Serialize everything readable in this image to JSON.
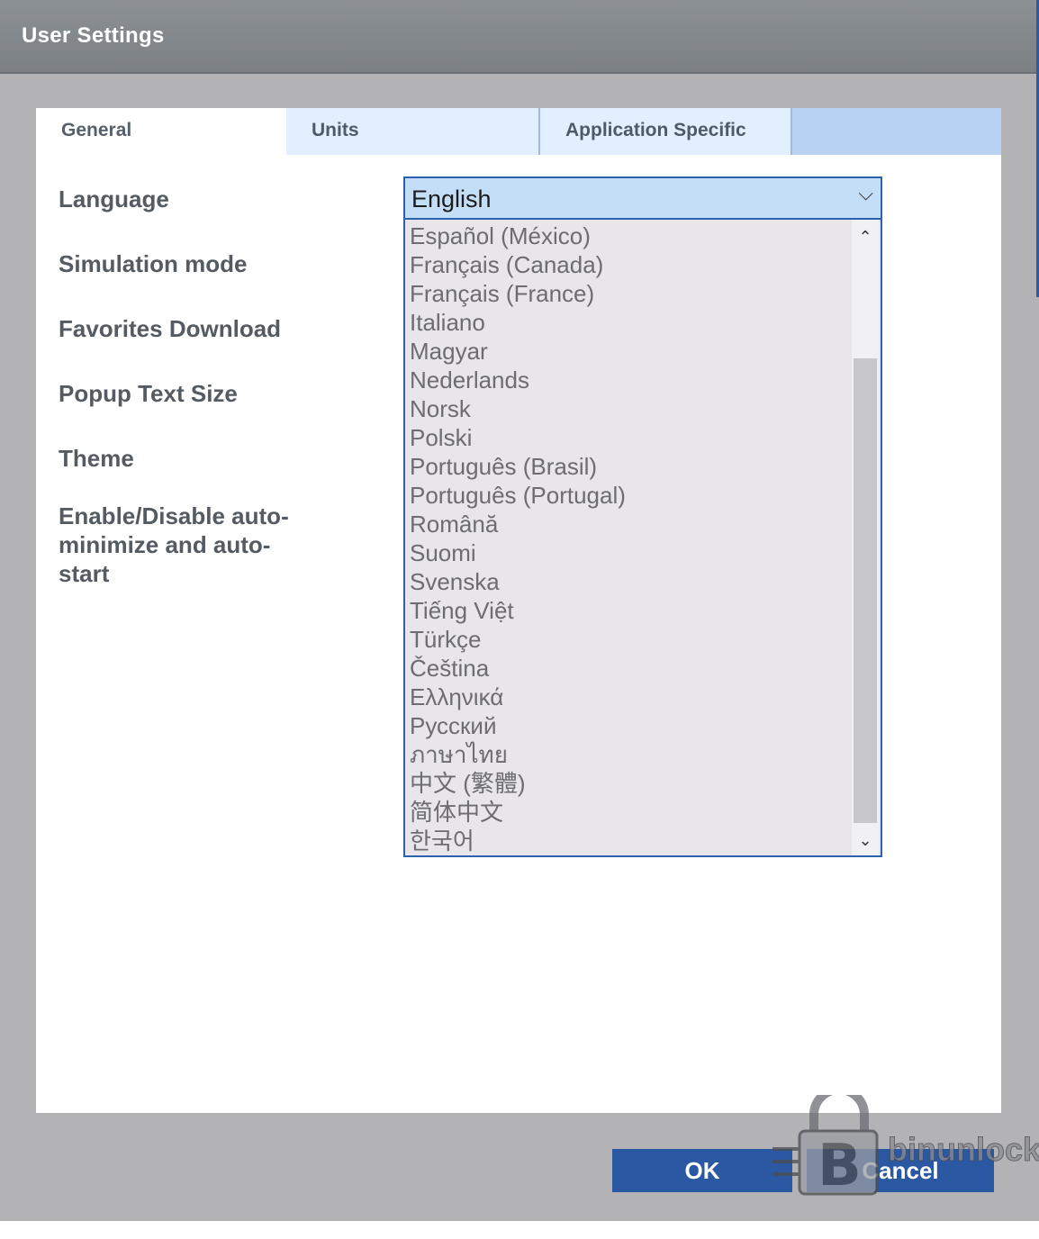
{
  "window": {
    "title": "User Settings"
  },
  "tabs": [
    {
      "label": "General",
      "active": true
    },
    {
      "label": "Units",
      "active": false
    },
    {
      "label": "Application Specific",
      "active": false
    }
  ],
  "settings": {
    "labels": [
      "Language",
      "Simulation mode",
      "Favorites Download",
      "Popup Text Size",
      "Theme",
      "Enable/Disable auto-minimize and auto-start"
    ]
  },
  "language_select": {
    "value": "English",
    "options": [
      "Español (México)",
      "Français (Canada)",
      "Français (France)",
      "Italiano",
      "Magyar",
      "Nederlands",
      "Norsk",
      "Polski",
      "Português (Brasil)",
      "Português (Portugal)",
      "Română",
      "Suomi",
      "Svenska",
      "Tiếng Việt",
      "Türkçe",
      "Čeština",
      "Ελληνικά",
      "Русский",
      "ภาษาไทย",
      "中文 (繁體)",
      "简体中文",
      "한국어"
    ]
  },
  "buttons": {
    "ok": "OK",
    "cancel": "Cancel"
  },
  "watermark": {
    "text": "binunlock"
  },
  "colors": {
    "titlebar": "#7b8085",
    "tab_strip": "#b9d3f5",
    "select_bg": "#c4def8",
    "accent_border": "#2a62b0",
    "button": "#2b58a2"
  }
}
